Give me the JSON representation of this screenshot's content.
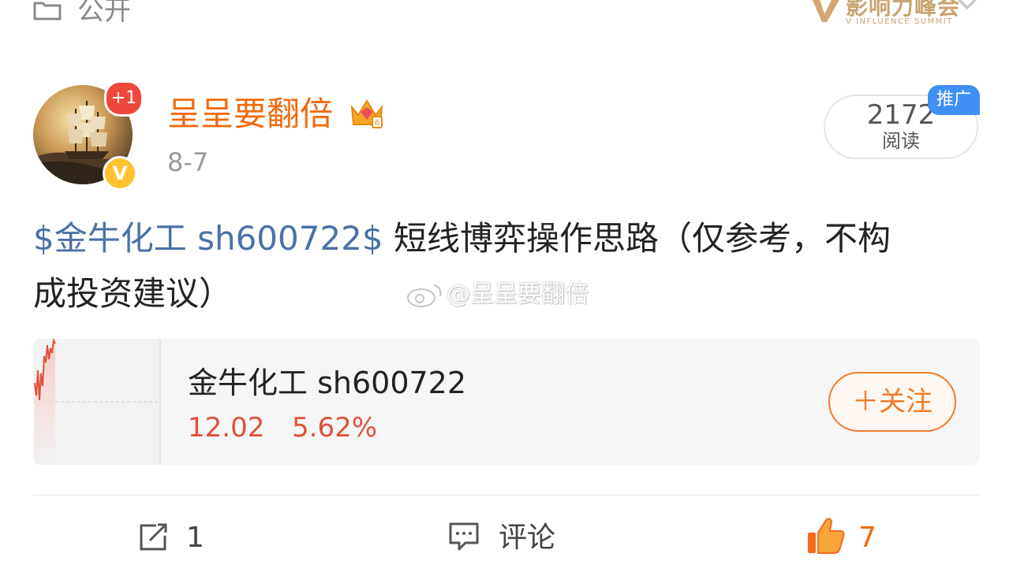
{
  "top": {
    "visibility_label": "公开",
    "event_logo_text": "影响力峰会",
    "event_logo_sub": "V INFLUENCE SUMMIT"
  },
  "author": {
    "name": "呈呈要翻倍",
    "date": "8-7",
    "new_badge": "+1",
    "verified_mark": "V"
  },
  "read_stat": {
    "count": "2172",
    "label": "阅读",
    "promo_tag": "推广"
  },
  "post": {
    "topic": "$金牛化工 sh600722$",
    "text_line1": " 短线博弈操作思路（仅参考，不构",
    "text_line2": "成投资建议）",
    "watermark": "@呈呈要翻倍"
  },
  "stock_card": {
    "name": "金牛化工 sh600722",
    "price": "12.02",
    "change": "5.62%",
    "follow_label": "＋关注"
  },
  "actions": {
    "repost_count": "1",
    "comment_label": "评论",
    "like_count": "7"
  },
  "colors": {
    "author_name": "#f06b0f",
    "topic": "#4a71a8",
    "price": "#e0503a",
    "accent": "#f07b2a",
    "promo": "#3f8ff5"
  },
  "icons": {
    "visibility": "folder-lock-icon",
    "crown": "crown-vip-icon",
    "repost": "repost-icon",
    "comment": "comment-icon",
    "like": "thumbs-up-icon"
  }
}
